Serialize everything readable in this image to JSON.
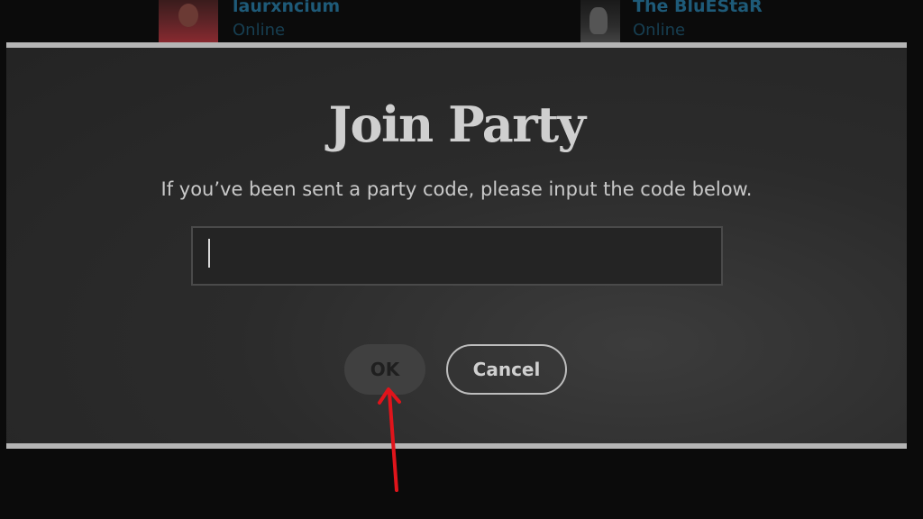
{
  "friends": [
    {
      "name": "laurxncium",
      "status": "Online"
    },
    {
      "name": "The BluEStaR",
      "status": "Online"
    }
  ],
  "dialog": {
    "title": "Join Party",
    "message": "If you’ve been sent a party code, please input the code below.",
    "code_value": "",
    "ok_label": "OK",
    "cancel_label": "Cancel"
  },
  "annotation": {
    "arrow_color": "#e0141b",
    "icon": "red-arrow-icon"
  },
  "colors": {
    "background": "#0b0b0b",
    "dialog_border": "#b5b5b5",
    "friend_name": "#1e5a78"
  }
}
